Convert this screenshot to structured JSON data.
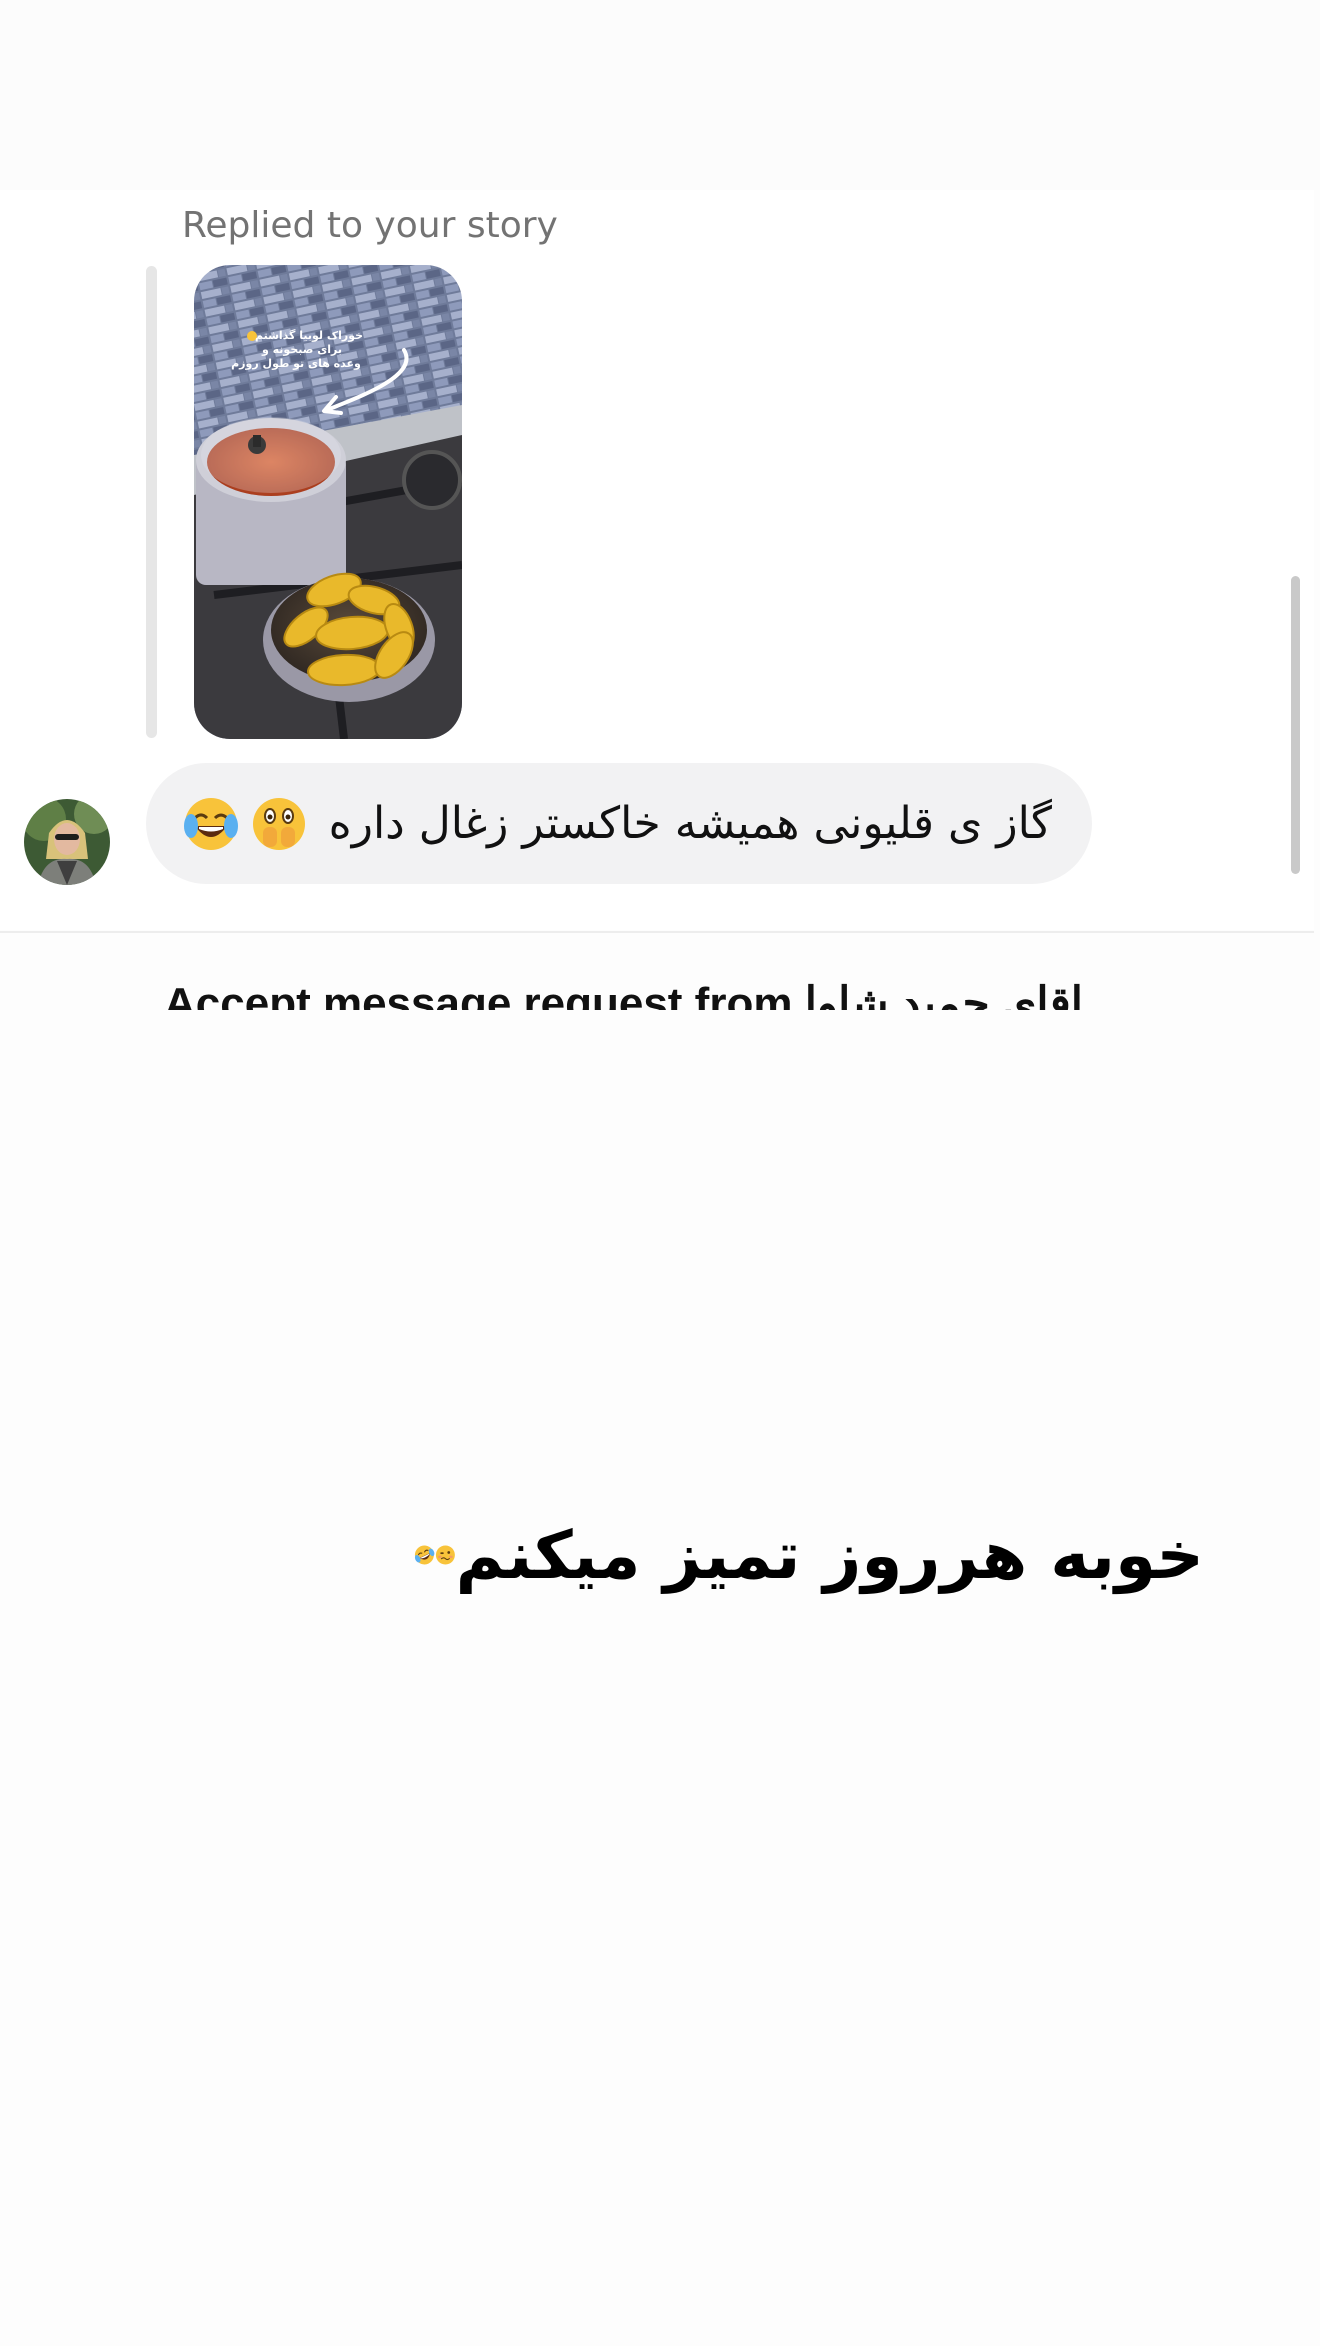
{
  "chat": {
    "reply_label": "Replied to your story",
    "story_overlay_lines": [
      "خوراک لوبیا گذاشتم",
      "برای صبحونه و",
      "وعده های تو طول روزم"
    ],
    "message_text": "گاز ی قلیونی همیشه خاکستر زغال داره",
    "message_emojis": [
      "face-with-open-eyes-hand-over-mouth-emoji",
      "tears-of-joy-emoji"
    ],
    "accept_request_text": "Accept message request from اقای حمید شاوا"
  },
  "caption": {
    "text": "خوبه هرروز تمیز میکنم",
    "emojis": [
      "woozy-face-emoji",
      "rolling-on-floor-laughing-emoji"
    ]
  },
  "colors": {
    "bubble_bg": "#f2f2f3",
    "label_gray": "#737373",
    "emoji_yellow": "#f8c33a"
  }
}
